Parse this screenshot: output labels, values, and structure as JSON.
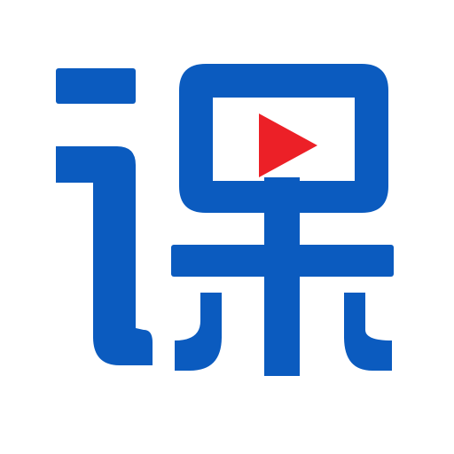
{
  "icon": {
    "glyph": "课",
    "colors": {
      "background": "#ffffff",
      "glyph": "#0b5bbf",
      "play": "#ec2027"
    },
    "icon_names": [
      "speech-radical-icon",
      "screen-frame-icon",
      "play-icon",
      "crossbar-icon",
      "stem-icon",
      "left-sweep-icon",
      "right-sweep-icon"
    ]
  }
}
